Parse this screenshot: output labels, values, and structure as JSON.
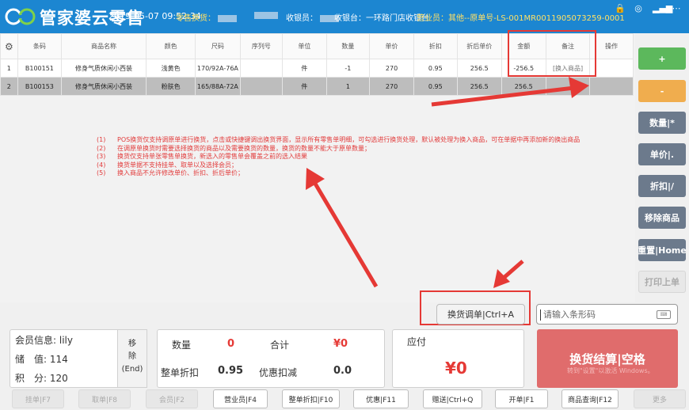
{
  "header": {
    "app_title": "管家婆云零售",
    "datetime": "2019-05-07 09:52:34",
    "mode": "零售换货",
    "mode_sep": "：",
    "cashier_label": "收银员：",
    "register_label": "收银台：",
    "register_value": "一环路门店收银台",
    "sales_label": "营业员：",
    "sales_value": "其他",
    "original_order": "--原单号-LS-001MR0011905073259-0001"
  },
  "table": {
    "columns": [
      "条码",
      "商品名称",
      "颜色",
      "尺码",
      "序列号",
      "单位",
      "数量",
      "单价",
      "折扣",
      "折后单价",
      "金额",
      "备注",
      "操作"
    ],
    "rows": [
      {
        "index": "1",
        "barcode": "B100151",
        "name": "修身气质休闲小西装",
        "color": "浅黄色",
        "size": "170/92A-76A",
        "serial": "",
        "unit": "件",
        "qty": "-1",
        "price": "270",
        "discount": "0.95",
        "disc_price": "256.5",
        "amount": "-256.5",
        "note": "[换入商品]",
        "action": ""
      },
      {
        "index": "2",
        "barcode": "B100153",
        "name": "修身气质休闲小西装",
        "color": "粉肤色",
        "size": "165/88A-72A",
        "serial": "",
        "unit": "件",
        "qty": "1",
        "price": "270",
        "discount": "0.95",
        "disc_price": "256.5",
        "amount": "256.5",
        "note": "",
        "action": ""
      }
    ]
  },
  "notes": [
    {
      "num": "(1)",
      "text": "POS换货仅支持调原单进行换货，点击或快捷键调出换货界面，显示所有零售单明细，可勾选进行换货处理，默认被处理为换入商品，可在单据中再添加新的换出商品"
    },
    {
      "num": "(2)",
      "text": "在调原单换货时需要选择换货的商品以及需要换货的数量，换货的数量不能大于原单数量；"
    },
    {
      "num": "(3)",
      "text": "换货仅支持单张零售单换货，新选入的零售单会覆盖之前的选入结果"
    },
    {
      "num": "(4)",
      "text": "换货单据不支持挂单、取单以及选择会员；"
    },
    {
      "num": "(5)",
      "text": "换入商品不允许修改单价、折扣、折后单价；"
    }
  ],
  "side_buttons": {
    "add": "+",
    "remove": "-",
    "qty": "数量|*",
    "price": "单价|.",
    "discount": "折扣|/",
    "remove_item": "移除商品",
    "reset": "重置|Home",
    "print_last": "打印上单"
  },
  "exchange": {
    "button": "换货调单|Ctrl+A",
    "barcode_placeholder": "请输入条形码"
  },
  "member": {
    "info_label": "会员信息:",
    "info_value": "lily",
    "stored_label": "储　值:",
    "stored_value": "114",
    "points_label": "积　分:",
    "points_value": "120",
    "remove_line1": "移",
    "remove_line2": "除",
    "remove_line3": "(End)"
  },
  "summary": {
    "qty_label": "数量",
    "qty_value": "0",
    "total_label": "合计",
    "total_value": "¥0",
    "order_discount_label": "整单折扣",
    "order_discount_value": "0.95",
    "promo_label": "优惠扣减",
    "promo_value": "0.0"
  },
  "payable": {
    "label": "应付",
    "value": "¥0"
  },
  "settle": {
    "label": "换货结算|空格",
    "watermark": "转到\"设置\"以激活 Windows。"
  },
  "toolbar": [
    {
      "label": "挂单|F7",
      "enabled": false
    },
    {
      "label": "取单|F8",
      "enabled": false
    },
    {
      "label": "会员|F2",
      "enabled": false
    },
    {
      "label": "营业员|F4",
      "enabled": true
    },
    {
      "label": "整单折扣|F10",
      "enabled": true
    },
    {
      "label": "优惠|F11",
      "enabled": true
    },
    {
      "label": "赠送|Ctrl+Q",
      "enabled": true
    },
    {
      "label": "开单|F1",
      "enabled": true
    },
    {
      "label": "商品查询|F12",
      "enabled": true
    },
    {
      "label": "更多",
      "enabled": false
    }
  ],
  "colors": {
    "title_bar": "#1c86d1",
    "highlight_red": "#e53935",
    "settle_red": "#e06c6c",
    "add_green": "#5cb85c",
    "remove_orange": "#f0ad4e",
    "side_gray": "#6c7a8c"
  },
  "icons": {
    "settings": "gear-icon",
    "lock": "lock-icon",
    "target": "target-icon",
    "signal": "signal-icon",
    "more": "more-icon",
    "keyboard": "keyboard-icon"
  }
}
